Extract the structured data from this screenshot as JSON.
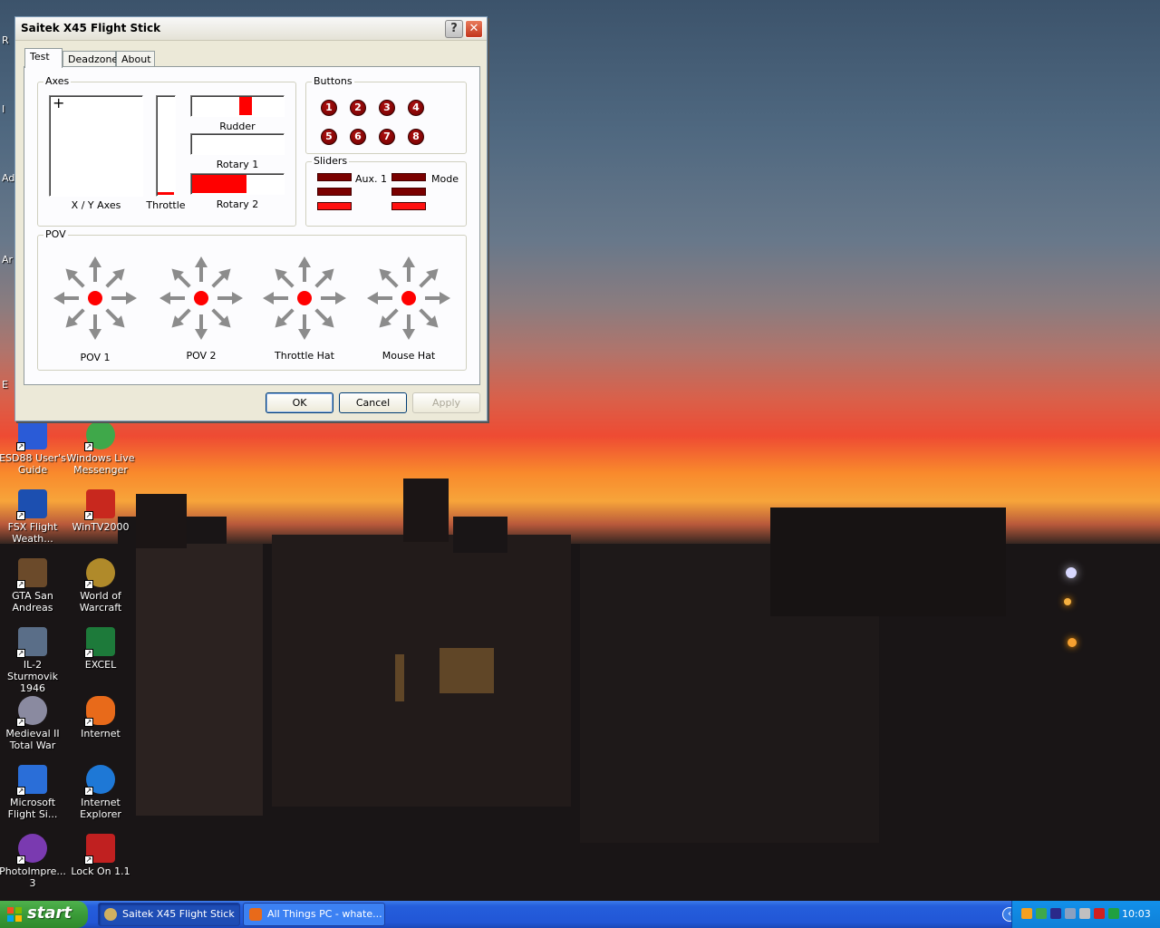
{
  "desktop": {
    "edge_labels": [
      "R",
      "I",
      "Ad",
      "Ar",
      "E"
    ],
    "icons": [
      {
        "label_line1": "ESD88 User's",
        "label_line2": "Guide",
        "icon": "book-icon",
        "color": "#2a5bd7"
      },
      {
        "label_line1": "Windows Live",
        "label_line2": "Messenger",
        "icon": "messenger-icon",
        "color": "#3fa84a"
      },
      {
        "label_line1": "FSX Flight",
        "label_line2": "Weath...",
        "icon": "fsx-weather-icon",
        "color": "#1c4fb0"
      },
      {
        "label_line1": "WinTV2000",
        "label_line2": "",
        "icon": "wintv-icon",
        "color": "#c8281e"
      },
      {
        "label_line1": "GTA San",
        "label_line2": "Andreas",
        "icon": "gta-icon",
        "color": "#6b4a2a"
      },
      {
        "label_line1": "World of",
        "label_line2": "Warcraft",
        "icon": "warcraft-icon",
        "color": "#b08a2a"
      },
      {
        "label_line1": "IL-2 Sturmovik",
        "label_line2": "1946",
        "icon": "il2-icon",
        "color": "#5a6e88"
      },
      {
        "label_line1": "EXCEL",
        "label_line2": "",
        "icon": "excel-icon",
        "color": "#1d7a3a"
      },
      {
        "label_line1": "Medieval II",
        "label_line2": "Total War",
        "icon": "medieval-icon",
        "color": "#8a8aa0"
      },
      {
        "label_line1": "Internet",
        "label_line2": "",
        "icon": "msn-butterfly-icon",
        "color": "#e86a1a"
      },
      {
        "label_line1": "Microsoft",
        "label_line2": "Flight Si...",
        "icon": "flight-sim-icon",
        "color": "#2a6ed8"
      },
      {
        "label_line1": "Internet",
        "label_line2": "Explorer",
        "icon": "ie-icon",
        "color": "#1e78d6"
      },
      {
        "label_line1": "PhotoImpre...",
        "label_line2": "3",
        "icon": "photoimpression-icon",
        "color": "#7a3ab0"
      },
      {
        "label_line1": "Lock On 1.1",
        "label_line2": "",
        "icon": "lockon-icon",
        "color": "#c02020"
      }
    ]
  },
  "dialog": {
    "title": "Saitek X45 Flight Stick",
    "tabs": [
      {
        "label": "Test",
        "active": true
      },
      {
        "label": "Deadzone",
        "active": false
      },
      {
        "label": "About",
        "active": false
      }
    ],
    "axes": {
      "legend": "Axes",
      "xy_label": "X / Y Axes",
      "throttle_label": "Throttle",
      "throttle_level": 0.03,
      "rudder_label": "Rudder",
      "rudder_position": 0.6,
      "rotary1_label": "Rotary 1",
      "rotary1_level": 0.0,
      "rotary2_label": "Rotary 2",
      "rotary2_level": 0.6
    },
    "buttons": {
      "legend": "Buttons",
      "items": [
        "1",
        "2",
        "3",
        "4",
        "5",
        "6",
        "7",
        "8"
      ]
    },
    "sliders": {
      "legend": "Sliders",
      "aux1_label": "Aux. 1",
      "mode_label": "Mode"
    },
    "pov": {
      "legend": "POV",
      "items": [
        "POV 1",
        "POV 2",
        "Throttle Hat",
        "Mouse Hat"
      ]
    },
    "ok_label": "OK",
    "cancel_label": "Cancel",
    "apply_label": "Apply",
    "accent_color": "#ff0000"
  },
  "taskbar": {
    "start_label": "start",
    "tasks": [
      {
        "label": "Saitek X45 Flight Stick",
        "active": true
      },
      {
        "label": "All Things PC - whate...",
        "active": false
      }
    ],
    "clock": "10:03"
  }
}
